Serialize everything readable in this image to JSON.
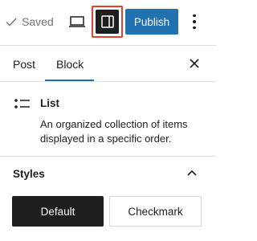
{
  "toolbar": {
    "saved_label": "Saved",
    "saved_icon": "check-icon",
    "view_icon": "laptop-icon",
    "settings_icon": "sidebar-panel-icon",
    "highlight_color": "#e2412f",
    "publish_label": "Publish",
    "publish_color": "#2271b1",
    "options_icon": "more-vertical-icon"
  },
  "sidebar": {
    "tabs": [
      {
        "label": "Post",
        "active": false
      },
      {
        "label": "Block",
        "active": true
      }
    ],
    "close_icon": "close-icon",
    "block": {
      "icon": "list-icon",
      "title": "List",
      "description": "An organized collection of items displayed in a specific order."
    },
    "styles": {
      "title": "Styles",
      "toggle_icon": "chevron-up-icon",
      "options": [
        {
          "label": "Default",
          "selected": true
        },
        {
          "label": "Checkmark",
          "selected": false
        }
      ]
    }
  }
}
